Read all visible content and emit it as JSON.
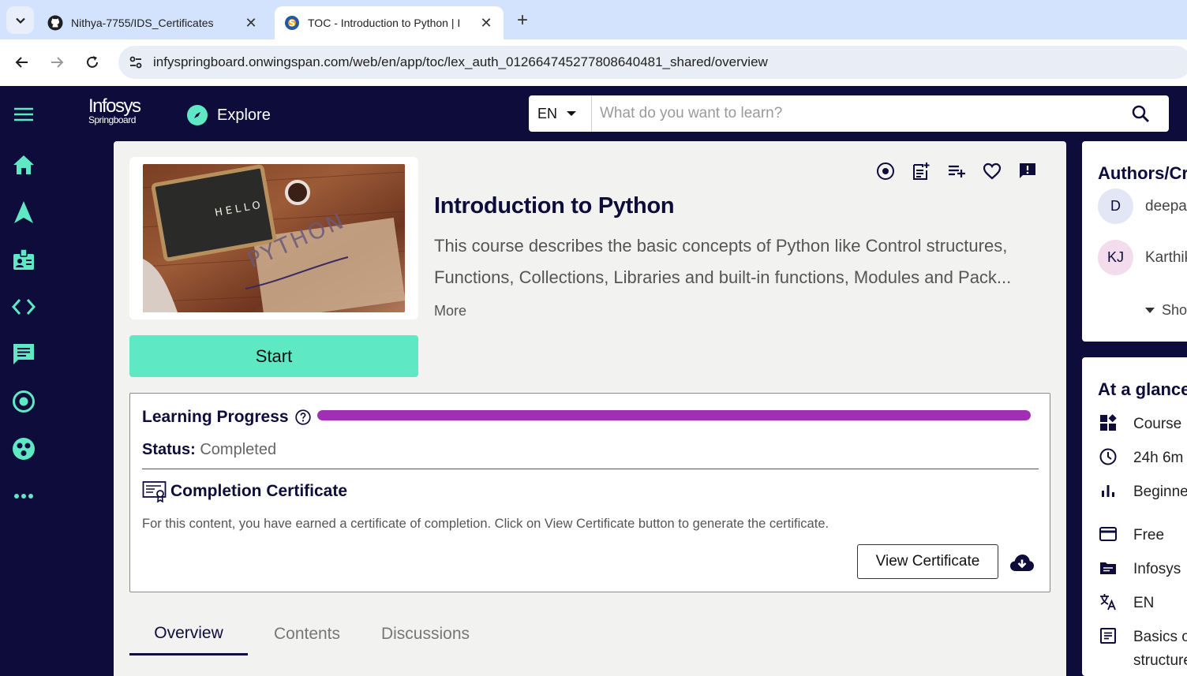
{
  "browser": {
    "tabs": [
      {
        "title": "Nithya-7755/IDS_Certificates",
        "active": false,
        "icon": "github-icon"
      },
      {
        "title": "TOC - Introduction to Python | I",
        "active": true,
        "icon": "springboard-favicon"
      }
    ],
    "url": "infyspringboard.onwingspan.com/web/en/app/toc/lex_auth_012664745277808640481_shared/overview"
  },
  "header": {
    "logo_line1": "Infosys",
    "logo_line2": "Springboard",
    "explore_label": "Explore",
    "language": "EN",
    "search_placeholder": "What do you want to learn?"
  },
  "sidebar": {
    "icons": [
      "menu-icon",
      "home-icon",
      "navigate-icon",
      "badge-icon",
      "code-icon",
      "chat-icon",
      "target-icon",
      "community-icon",
      "more-icon"
    ]
  },
  "course": {
    "thumbnail_text_1": "HELLO",
    "thumbnail_text_2": "PYTHON",
    "title": "Introduction to Python",
    "description": "This course describes the basic concepts of Python like Control structures, Functions, Collections, Libraries and built-in functions, Modules and Pack...",
    "more_label": "More",
    "start_label": "Start"
  },
  "progress": {
    "label": "Learning Progress",
    "percent": 100,
    "status_label": "Status:",
    "status_value": "Completed",
    "certificate_title": "Completion Certificate",
    "certificate_text": "For this content, you have earned a certificate of completion. Click on View Certificate button to generate the certificate.",
    "view_certificate_label": "View Certificate"
  },
  "page_tabs": [
    {
      "label": "Overview",
      "active": true
    },
    {
      "label": "Contents",
      "active": false
    },
    {
      "label": "Discussions",
      "active": false
    }
  ],
  "authors": {
    "heading": "Authors/Creators",
    "list": [
      {
        "initials": "D",
        "name": "deepa"
      },
      {
        "initials": "KJ",
        "name": "Karthik"
      }
    ],
    "show_more_label": "Show more"
  },
  "glance": {
    "heading": "At a glance",
    "items": [
      {
        "icon": "category-icon",
        "text": "Course"
      },
      {
        "icon": "clock-icon",
        "text": "24h 6m"
      },
      {
        "icon": "level-icon",
        "text": "Beginner"
      },
      {
        "icon": "card-icon",
        "text": "Free"
      },
      {
        "icon": "folder-icon",
        "text": "Infosys"
      },
      {
        "icon": "translate-icon",
        "text": "EN"
      },
      {
        "icon": "topics-icon",
        "text": "Basics of",
        "text2": "structures"
      }
    ]
  },
  "colors": {
    "navy": "#0e0c3a",
    "accent": "#5ee8c3",
    "progress": "#a12fb3"
  }
}
